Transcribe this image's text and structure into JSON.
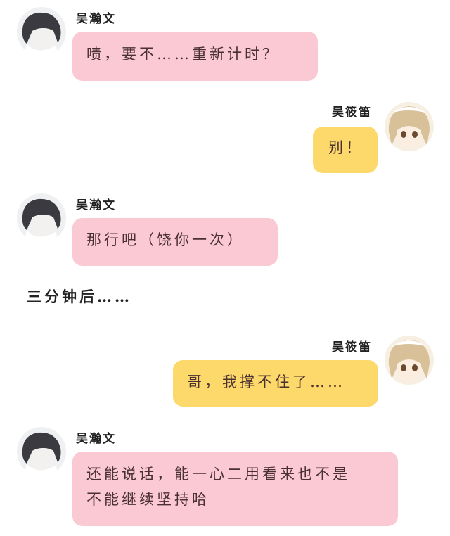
{
  "participants": {
    "left": {
      "name": "吴瀚文",
      "avatar": "boy-avatar-icon"
    },
    "right": {
      "name": "吴筱笛",
      "avatar": "girl-avatar-icon"
    }
  },
  "colors": {
    "left_bubble": "#fbc9d3",
    "right_bubble": "#fdd86a"
  },
  "messages": [
    {
      "side": "left",
      "sender": "吴瀚文",
      "text": "啧，要不……重新计时？"
    },
    {
      "side": "right",
      "sender": "吴筱笛",
      "text": "别！"
    },
    {
      "side": "left",
      "sender": "吴瀚文",
      "text": "那行吧（饶你一次）"
    },
    {
      "side": "right",
      "sender": "吴筱笛",
      "text": "哥，我撑不住了……"
    },
    {
      "side": "left",
      "sender": "吴瀚文",
      "text_lines": [
        "还能说话，能一心二用看来也不是",
        "不能继续坚持哈"
      ]
    }
  ],
  "narration": "三分钟后……"
}
